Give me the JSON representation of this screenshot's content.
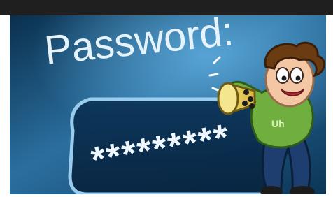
{
  "image": {
    "screen_label": "Password:",
    "masked_text": "*********",
    "character": {
      "megaphone_icon": "megaphone-icon",
      "shirt_badge": "Uh"
    },
    "colors": {
      "top_bar": "#1f1f1f",
      "screen_bg_dark": "#0a2f4d",
      "screen_bg_light": "#3e88b7",
      "shirt": "#6fae3f",
      "pants": "#1d3e6f",
      "hair": "#6b3b12",
      "megaphone": "#e8cf5b"
    }
  }
}
